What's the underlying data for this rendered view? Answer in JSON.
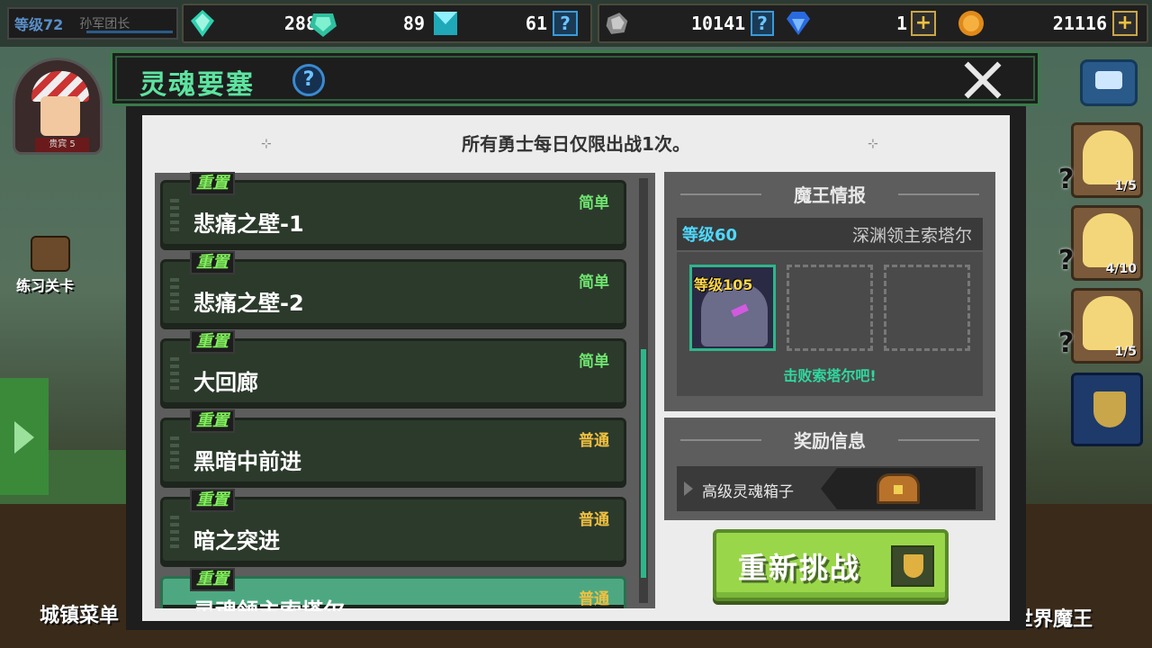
{
  "player": {
    "level": "等级72",
    "rank": "孙军团长"
  },
  "resources": [
    {
      "icon": "soul-crystal-icon",
      "value": "288"
    },
    {
      "icon": "green-gem-icon",
      "value": "89"
    },
    {
      "icon": "cyan-gem-icon",
      "value": "61"
    },
    {
      "icon": "iron-ore-icon",
      "value": "10141"
    },
    {
      "icon": "diamond-icon",
      "value": "1"
    },
    {
      "icon": "gold-coin-icon",
      "value": "21116"
    }
  ],
  "avatar": {
    "tag": "贵宾 5"
  },
  "side": {
    "practice_label": "练习关卡",
    "town_menu": "城镇菜单",
    "world_boss": "世界魔王"
  },
  "hero_cards": [
    "1/5",
    "4/10",
    "1/5"
  ],
  "modal": {
    "title": "灵魂要塞",
    "notice": "所有勇士每日仅限出战1次。",
    "stages": [
      {
        "reset": "重置",
        "name": "悲痛之壁-1",
        "difficulty": "简单",
        "diff_color": "#6fe46f"
      },
      {
        "reset": "重置",
        "name": "悲痛之壁-2",
        "difficulty": "简单",
        "diff_color": "#6fe46f"
      },
      {
        "reset": "重置",
        "name": "大回廊",
        "difficulty": "简单",
        "diff_color": "#6fe46f"
      },
      {
        "reset": "重置",
        "name": "黑暗中前进",
        "difficulty": "普通",
        "diff_color": "#f0c040"
      },
      {
        "reset": "重置",
        "name": "暗之突进",
        "difficulty": "普通",
        "diff_color": "#f0c040"
      },
      {
        "reset": "重置",
        "name": "灵魂领主索塔尔",
        "difficulty": "普通",
        "diff_color": "#f0c040"
      }
    ],
    "boss": {
      "header": "魔王情报",
      "level": "等级60",
      "name": "深渊领主索塔尔",
      "monster_level": "等级105",
      "defeat_text": "击败索塔尔吧!"
    },
    "reward": {
      "header": "奖励信息",
      "item": "高级灵魂箱子"
    },
    "retry_label": "重新挑战"
  }
}
